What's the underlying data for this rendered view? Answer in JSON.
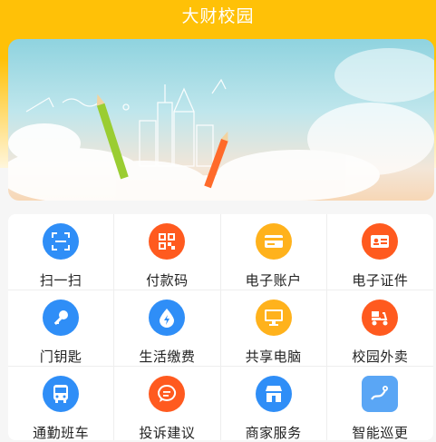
{
  "header": {
    "title": "大财校园"
  },
  "banner": {
    "image": "campus-sky-illustration"
  },
  "services": [
    {
      "label": "扫一扫",
      "icon": "scan-icon",
      "color": "#2f8ef7"
    },
    {
      "label": "付款码",
      "icon": "qrcode-icon",
      "color": "#ff5a1f"
    },
    {
      "label": "电子账户",
      "icon": "card-icon",
      "color": "#ffb21c"
    },
    {
      "label": "电子证件",
      "icon": "id-card-icon",
      "color": "#ff5a1f"
    },
    {
      "label": "门钥匙",
      "icon": "key-icon",
      "color": "#2f8ef7"
    },
    {
      "label": "生活缴费",
      "icon": "lightning-drop-icon",
      "color": "#2f8ef7"
    },
    {
      "label": "共享电脑",
      "icon": "monitor-icon",
      "color": "#ffb21c"
    },
    {
      "label": "校园外卖",
      "icon": "delivery-scooter-icon",
      "color": "#ff5a1f"
    },
    {
      "label": "通勤班车",
      "icon": "bus-icon",
      "color": "#2f8ef7"
    },
    {
      "label": "投诉建议",
      "icon": "chat-bubble-icon",
      "color": "#ff5a1f"
    },
    {
      "label": "商家服务",
      "icon": "shop-icon",
      "color": "#2f8ef7"
    },
    {
      "label": "智能巡更",
      "icon": "map-route-icon",
      "color": "#2f8ef7"
    }
  ]
}
